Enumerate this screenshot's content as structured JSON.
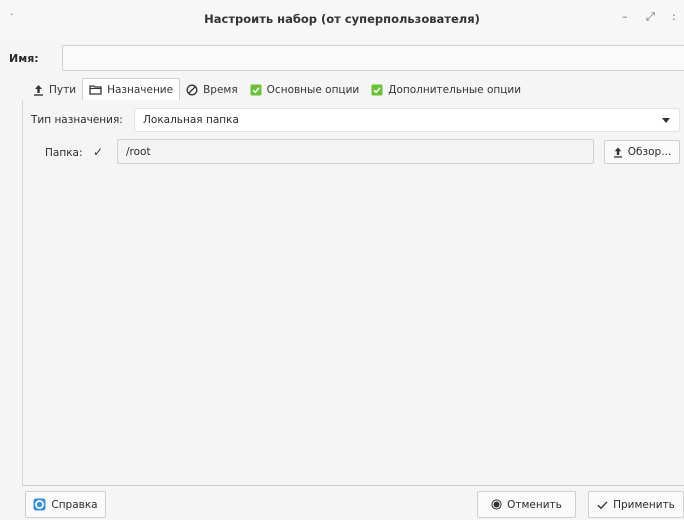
{
  "window": {
    "title": "Настроить набор (от суперпользователя)",
    "dot": "·",
    "minimize": "–",
    "maximize": "⤢",
    "close": ":"
  },
  "name_field": {
    "label": "Имя:",
    "value": ""
  },
  "tabs": [
    {
      "label": "Пути",
      "icon": "upload-icon"
    },
    {
      "label": "Назначение",
      "icon": "folder-icon",
      "active": true
    },
    {
      "label": "Время",
      "icon": "clock-off-icon"
    },
    {
      "label": "Основные опции",
      "icon": "green-check-icon"
    },
    {
      "label": "Дополнительные опции",
      "icon": "green-check-icon"
    }
  ],
  "destination": {
    "type_label": "Тип назначения:",
    "type_value": "Локальная папка",
    "folder_label": "Папка:",
    "folder_check": "✓",
    "folder_value": "/root",
    "browse_label": "Обзор..."
  },
  "buttons": {
    "help": "Справка",
    "cancel": "Отменить",
    "apply": "Применить"
  },
  "colors": {
    "accent_green": "#6cbf3a",
    "help_blue": "#3a8fd8"
  }
}
